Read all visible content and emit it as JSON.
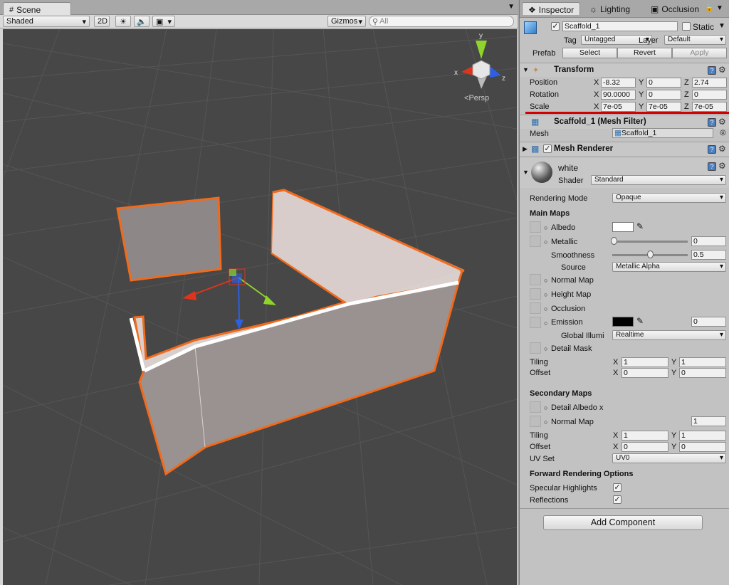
{
  "scene": {
    "tab_label": "Scene",
    "shading_mode": "Shaded",
    "btn_2d": "2D",
    "gizmos_label": "Gizmos",
    "search_placeholder": "All",
    "persp_label": "Persp",
    "axis_x": "x",
    "axis_y": "y",
    "axis_z": "z"
  },
  "inspector": {
    "tabs": [
      "Inspector",
      "Lighting",
      "Occlusion"
    ],
    "object_name": "Scaffold_1",
    "static_label": "Static",
    "tag_label": "Tag",
    "tag_value": "Untagged",
    "layer_label": "Layer",
    "layer_value": "Default",
    "prefab_label": "Prefab",
    "prefab_select": "Select",
    "prefab_revert": "Revert",
    "prefab_apply": "Apply",
    "transform": {
      "title": "Transform",
      "position_label": "Position",
      "rotation_label": "Rotation",
      "scale_label": "Scale",
      "position": {
        "x": "-8.32",
        "y": "0",
        "z": "2.74"
      },
      "rotation": {
        "x": "90.0000",
        "y": "0",
        "z": "0"
      },
      "scale": {
        "x": "7e-05",
        "y": "7e-05",
        "z": "7e-05"
      }
    },
    "mesh_filter": {
      "title": "Scaffold_1 (Mesh Filter)",
      "mesh_label": "Mesh",
      "mesh_value": "Scaffold_1"
    },
    "mesh_renderer": {
      "title": "Mesh Renderer"
    },
    "material": {
      "name": "white",
      "shader_label": "Shader",
      "shader_value": "Standard",
      "rendering_mode_label": "Rendering Mode",
      "rendering_mode_value": "Opaque",
      "main_maps": "Main Maps",
      "albedo": "Albedo",
      "metallic": "Metallic",
      "metallic_value": "0",
      "metallic_level": 0.0,
      "smoothness": "Smoothness",
      "smoothness_value": "0.5",
      "smoothness_level": 0.5,
      "source": "Source",
      "source_value": "Metallic Alpha",
      "normal_map": "Normal Map",
      "height_map": "Height Map",
      "occlusion": "Occlusion",
      "emission": "Emission",
      "emission_value": "0",
      "global_illum": "Global Illumi",
      "global_illum_value": "Realtime",
      "detail_mask": "Detail Mask",
      "tiling": "Tiling",
      "offset": "Offset",
      "tiling_x": "1",
      "tiling_y": "1",
      "offset_x": "0",
      "offset_y": "0",
      "secondary_maps": "Secondary Maps",
      "detail_albedo": "Detail Albedo x",
      "sec_normal_map": "Normal Map",
      "sec_normal_value": "1",
      "sec_tiling_x": "1",
      "sec_tiling_y": "1",
      "sec_offset_x": "0",
      "sec_offset_y": "0",
      "uv_set": "UV Set",
      "uv_set_value": "UV0",
      "forward_options": "Forward Rendering Options",
      "specular_highlights": "Specular Highlights",
      "reflections": "Reflections",
      "label_x": "X",
      "label_y": "Y",
      "label_z": "Z"
    },
    "add_component": "Add Component"
  },
  "colors": {
    "viewport_bg": "#474747",
    "selection_outline": "#f26a1b",
    "highlight_line": "#d40000",
    "axis_red": "#e0331b",
    "axis_green": "#8ed42a",
    "axis_blue": "#2e5fe0"
  }
}
